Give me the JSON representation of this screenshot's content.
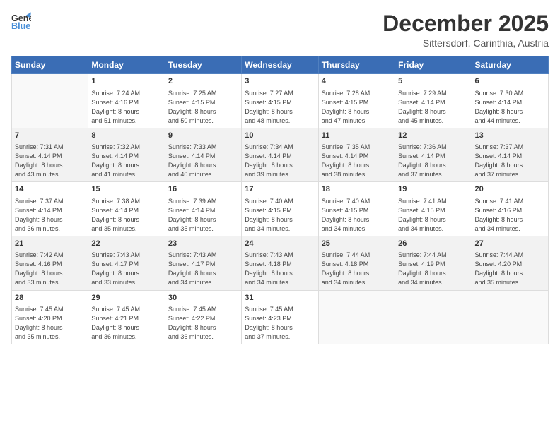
{
  "logo": {
    "general": "General",
    "blue": "Blue"
  },
  "header": {
    "month": "December 2025",
    "location": "Sittersdorf, Carinthia, Austria"
  },
  "weekdays": [
    "Sunday",
    "Monday",
    "Tuesday",
    "Wednesday",
    "Thursday",
    "Friday",
    "Saturday"
  ],
  "weeks": [
    [
      {
        "day": "",
        "sunrise": "",
        "sunset": "",
        "daylight": ""
      },
      {
        "day": "1",
        "sunrise": "Sunrise: 7:24 AM",
        "sunset": "Sunset: 4:16 PM",
        "daylight": "Daylight: 8 hours and 51 minutes."
      },
      {
        "day": "2",
        "sunrise": "Sunrise: 7:25 AM",
        "sunset": "Sunset: 4:15 PM",
        "daylight": "Daylight: 8 hours and 50 minutes."
      },
      {
        "day": "3",
        "sunrise": "Sunrise: 7:27 AM",
        "sunset": "Sunset: 4:15 PM",
        "daylight": "Daylight: 8 hours and 48 minutes."
      },
      {
        "day": "4",
        "sunrise": "Sunrise: 7:28 AM",
        "sunset": "Sunset: 4:15 PM",
        "daylight": "Daylight: 8 hours and 47 minutes."
      },
      {
        "day": "5",
        "sunrise": "Sunrise: 7:29 AM",
        "sunset": "Sunset: 4:14 PM",
        "daylight": "Daylight: 8 hours and 45 minutes."
      },
      {
        "day": "6",
        "sunrise": "Sunrise: 7:30 AM",
        "sunset": "Sunset: 4:14 PM",
        "daylight": "Daylight: 8 hours and 44 minutes."
      }
    ],
    [
      {
        "day": "7",
        "sunrise": "Sunrise: 7:31 AM",
        "sunset": "Sunset: 4:14 PM",
        "daylight": "Daylight: 8 hours and 43 minutes."
      },
      {
        "day": "8",
        "sunrise": "Sunrise: 7:32 AM",
        "sunset": "Sunset: 4:14 PM",
        "daylight": "Daylight: 8 hours and 41 minutes."
      },
      {
        "day": "9",
        "sunrise": "Sunrise: 7:33 AM",
        "sunset": "Sunset: 4:14 PM",
        "daylight": "Daylight: 8 hours and 40 minutes."
      },
      {
        "day": "10",
        "sunrise": "Sunrise: 7:34 AM",
        "sunset": "Sunset: 4:14 PM",
        "daylight": "Daylight: 8 hours and 39 minutes."
      },
      {
        "day": "11",
        "sunrise": "Sunrise: 7:35 AM",
        "sunset": "Sunset: 4:14 PM",
        "daylight": "Daylight: 8 hours and 38 minutes."
      },
      {
        "day": "12",
        "sunrise": "Sunrise: 7:36 AM",
        "sunset": "Sunset: 4:14 PM",
        "daylight": "Daylight: 8 hours and 37 minutes."
      },
      {
        "day": "13",
        "sunrise": "Sunrise: 7:37 AM",
        "sunset": "Sunset: 4:14 PM",
        "daylight": "Daylight: 8 hours and 37 minutes."
      }
    ],
    [
      {
        "day": "14",
        "sunrise": "Sunrise: 7:37 AM",
        "sunset": "Sunset: 4:14 PM",
        "daylight": "Daylight: 8 hours and 36 minutes."
      },
      {
        "day": "15",
        "sunrise": "Sunrise: 7:38 AM",
        "sunset": "Sunset: 4:14 PM",
        "daylight": "Daylight: 8 hours and 35 minutes."
      },
      {
        "day": "16",
        "sunrise": "Sunrise: 7:39 AM",
        "sunset": "Sunset: 4:14 PM",
        "daylight": "Daylight: 8 hours and 35 minutes."
      },
      {
        "day": "17",
        "sunrise": "Sunrise: 7:40 AM",
        "sunset": "Sunset: 4:15 PM",
        "daylight": "Daylight: 8 hours and 34 minutes."
      },
      {
        "day": "18",
        "sunrise": "Sunrise: 7:40 AM",
        "sunset": "Sunset: 4:15 PM",
        "daylight": "Daylight: 8 hours and 34 minutes."
      },
      {
        "day": "19",
        "sunrise": "Sunrise: 7:41 AM",
        "sunset": "Sunset: 4:15 PM",
        "daylight": "Daylight: 8 hours and 34 minutes."
      },
      {
        "day": "20",
        "sunrise": "Sunrise: 7:41 AM",
        "sunset": "Sunset: 4:16 PM",
        "daylight": "Daylight: 8 hours and 34 minutes."
      }
    ],
    [
      {
        "day": "21",
        "sunrise": "Sunrise: 7:42 AM",
        "sunset": "Sunset: 4:16 PM",
        "daylight": "Daylight: 8 hours and 33 minutes."
      },
      {
        "day": "22",
        "sunrise": "Sunrise: 7:43 AM",
        "sunset": "Sunset: 4:17 PM",
        "daylight": "Daylight: 8 hours and 33 minutes."
      },
      {
        "day": "23",
        "sunrise": "Sunrise: 7:43 AM",
        "sunset": "Sunset: 4:17 PM",
        "daylight": "Daylight: 8 hours and 34 minutes."
      },
      {
        "day": "24",
        "sunrise": "Sunrise: 7:43 AM",
        "sunset": "Sunset: 4:18 PM",
        "daylight": "Daylight: 8 hours and 34 minutes."
      },
      {
        "day": "25",
        "sunrise": "Sunrise: 7:44 AM",
        "sunset": "Sunset: 4:18 PM",
        "daylight": "Daylight: 8 hours and 34 minutes."
      },
      {
        "day": "26",
        "sunrise": "Sunrise: 7:44 AM",
        "sunset": "Sunset: 4:19 PM",
        "daylight": "Daylight: 8 hours and 34 minutes."
      },
      {
        "day": "27",
        "sunrise": "Sunrise: 7:44 AM",
        "sunset": "Sunset: 4:20 PM",
        "daylight": "Daylight: 8 hours and 35 minutes."
      }
    ],
    [
      {
        "day": "28",
        "sunrise": "Sunrise: 7:45 AM",
        "sunset": "Sunset: 4:20 PM",
        "daylight": "Daylight: 8 hours and 35 minutes."
      },
      {
        "day": "29",
        "sunrise": "Sunrise: 7:45 AM",
        "sunset": "Sunset: 4:21 PM",
        "daylight": "Daylight: 8 hours and 36 minutes."
      },
      {
        "day": "30",
        "sunrise": "Sunrise: 7:45 AM",
        "sunset": "Sunset: 4:22 PM",
        "daylight": "Daylight: 8 hours and 36 minutes."
      },
      {
        "day": "31",
        "sunrise": "Sunrise: 7:45 AM",
        "sunset": "Sunset: 4:23 PM",
        "daylight": "Daylight: 8 hours and 37 minutes."
      },
      {
        "day": "",
        "sunrise": "",
        "sunset": "",
        "daylight": ""
      },
      {
        "day": "",
        "sunrise": "",
        "sunset": "",
        "daylight": ""
      },
      {
        "day": "",
        "sunrise": "",
        "sunset": "",
        "daylight": ""
      }
    ]
  ]
}
